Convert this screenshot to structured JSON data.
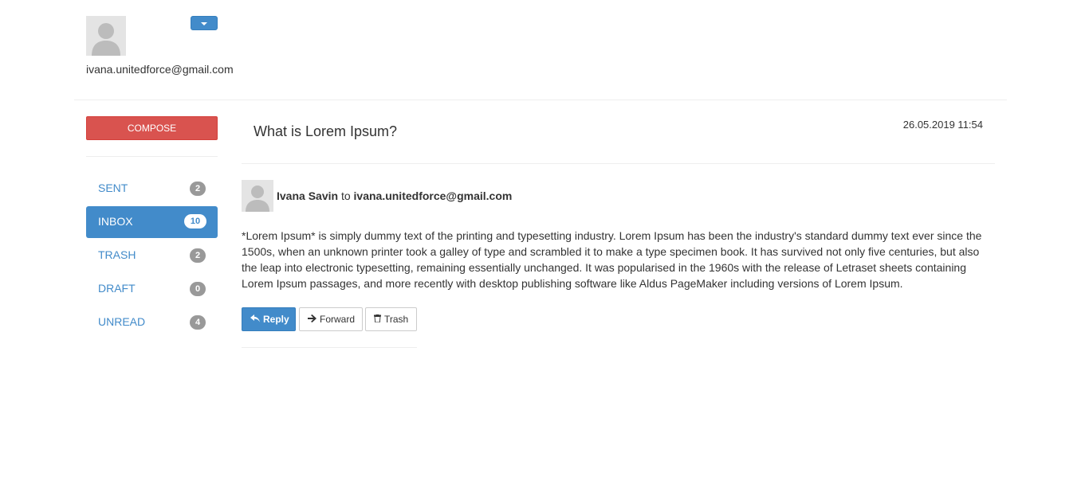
{
  "user": {
    "email": "ivana.unitedforce@gmail.com"
  },
  "sidebar": {
    "compose_label": "COMPOSE",
    "items": [
      {
        "label": "SENT",
        "count": "2"
      },
      {
        "label": "INBOX",
        "count": "10"
      },
      {
        "label": "TRASH",
        "count": "2"
      },
      {
        "label": "DRAFT",
        "count": "0"
      },
      {
        "label": "UNREAD",
        "count": "4"
      }
    ],
    "active_item": "INBOX"
  },
  "message": {
    "subject": "What is Lorem Ipsum?",
    "date": "26.05.2019 11:54",
    "sender_name": "Ivana Savin",
    "to_word": "to",
    "recipient": "ivana.unitedforce@gmail.com",
    "body": "*Lorem Ipsum* is simply dummy text of the printing and typesetting industry. Lorem Ipsum has been the industry's standard dummy text ever since the 1500s, when an unknown printer took a galley of type and scrambled it to make a type specimen book. It has survived not only five centuries, but also the leap into electronic typesetting, remaining essentially unchanged. It was popularised in the 1960s with the release of Letraset sheets containing Lorem Ipsum passages, and more recently with desktop publishing software like Aldus PageMaker including versions of Lorem Ipsum."
  },
  "actions": {
    "reply_label": "Reply",
    "forward_label": "Forward",
    "trash_label": "Trash",
    "reply_icon": "reply-icon",
    "forward_icon": "arrow-right-icon",
    "trash_icon": "trash-icon"
  },
  "colors": {
    "primary": "#428bca",
    "danger": "#d9534f",
    "badge": "#999999"
  }
}
